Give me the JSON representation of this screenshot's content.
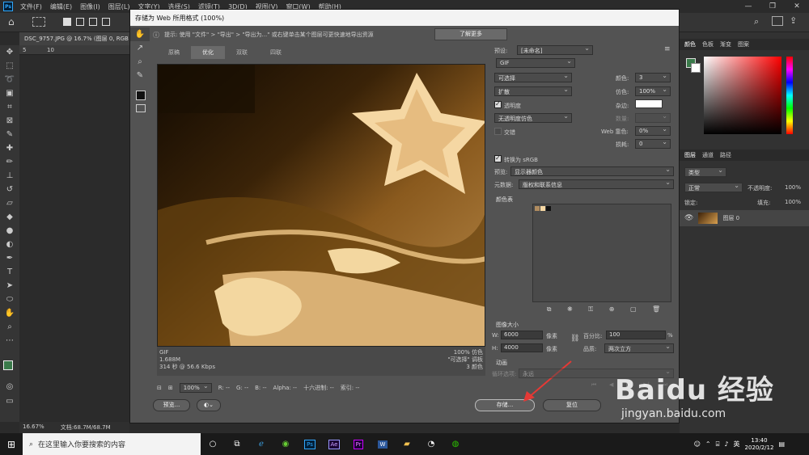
{
  "app": {
    "menu": [
      "文件(F)",
      "编辑(E)",
      "图像(I)",
      "图层(L)",
      "文字(Y)",
      "选择(S)",
      "滤镜(T)",
      "3D(D)",
      "视图(V)",
      "窗口(W)",
      "帮助(H)"
    ],
    "logo": "Ps"
  },
  "document": {
    "tab": "DSC_9757.JPG @ 16.7% (图层 0, RGB",
    "zoom": "16.67%",
    "doc_size": "文档:68.7M/68.7M",
    "ruler": [
      "5",
      "10"
    ]
  },
  "dialog": {
    "title": "存储为 Web 所用格式 (100%)",
    "hint": "提示: 使用 \"文件\" > \"导出\" > \"导出为...\" 或右键单击某个图层可更快速地导出资源",
    "learn_more": "了解更多",
    "tabs": [
      "原稿",
      "优化",
      "双联",
      "四联"
    ],
    "active_tab": "优化",
    "info_left": [
      "GIF",
      "1.688M",
      "314 秒 @ 56.6 Kbps"
    ],
    "info_right": [
      "100% 仿色",
      "\"可选择\" 调板",
      "3 颜色"
    ],
    "zoom": "100%",
    "readouts": {
      "r": "R: --",
      "g": "G: --",
      "b": "B: --",
      "alpha": "Alpha: --",
      "hex": "十六进制: --",
      "index": "索引: --"
    },
    "preview_btn": "预览...",
    "save_btn": "存储...",
    "reset_btn": "复位"
  },
  "settings": {
    "preset_label": "预设:",
    "preset_value": "[未命名]",
    "format": "GIF",
    "palette": "可选择",
    "dither": "扩散",
    "colors_label": "颜色:",
    "colors_value": "3",
    "dither_amount_label": "仿色:",
    "dither_amount": "100%",
    "transparency_label": "透明度",
    "matte_label": "杂边:",
    "trans_dither": "无透明度仿色",
    "amount_label": "数量:",
    "interlace_label": "交错",
    "web_snap_label": "Web 靠色:",
    "web_snap": "0%",
    "lossy_label": "损耗:",
    "lossy": "0",
    "srgb_label": "转换为 sRGB",
    "preview_label": "预览:",
    "preview_value": "显示器颜色",
    "metadata_label": "元数据:",
    "metadata_value": "版权和联系信息",
    "color_table": "颜色表",
    "image_size": "图像大小",
    "w_label": "W:",
    "w_value": "6000",
    "h_label": "H:",
    "h_value": "4000",
    "px": "像素",
    "percent_label": "百分比:",
    "percent_value": "100",
    "percent_unit": "%",
    "quality_label": "品质:",
    "quality_value": "两次立方",
    "animation": "动画",
    "loop_label": "循环选项:",
    "loop_value": "永远"
  },
  "right_panel": {
    "tabs_top": [
      "颜色",
      "色板",
      "渐变",
      "图案"
    ],
    "tabs_layers": [
      "图层",
      "通道",
      "路径"
    ],
    "kind": "类型",
    "blend": "正常",
    "opacity": "不透明度:",
    "opacity_value": "100%",
    "lock": "锁定:",
    "fill": "填充:",
    "fill_value": "100%",
    "layer": "图层 0"
  },
  "taskbar": {
    "search": "在这里输入你要搜索的内容",
    "ime": "英",
    "time": "13:40",
    "date": "2020/2/12"
  },
  "watermark": {
    "brand": "Baidu 经验",
    "url": "jingyan.baidu.com"
  },
  "colors": {
    "swatch1": "#b08c60",
    "swatch2": "#f5d7a3",
    "swatch3": "#111111",
    "accent": "#31a8ff",
    "annotation": "#e53935"
  }
}
